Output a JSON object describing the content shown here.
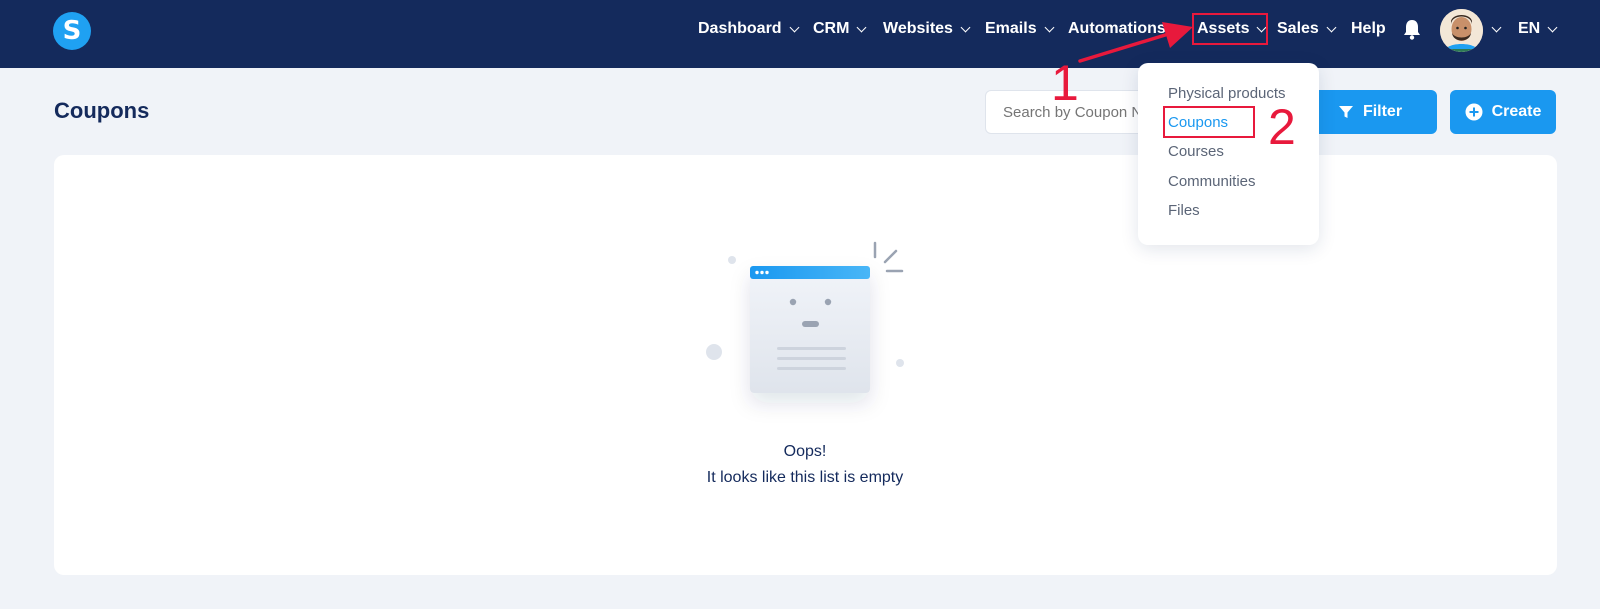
{
  "header": {
    "logo_letter": "S",
    "nav": [
      {
        "label": "Dashboard",
        "chevron": true
      },
      {
        "label": "CRM",
        "chevron": true
      },
      {
        "label": "Websites",
        "chevron": true
      },
      {
        "label": "Emails",
        "chevron": true
      },
      {
        "label": "Automations",
        "chevron": false
      },
      {
        "label": "Assets",
        "chevron": true
      },
      {
        "label": "Sales",
        "chevron": true
      },
      {
        "label": "Help",
        "chevron": false
      }
    ],
    "lang": "EN",
    "icons": [
      "bell-icon",
      "avatar"
    ]
  },
  "page": {
    "title": "Coupons",
    "search_placeholder": "Search by Coupon N",
    "filter_label": "Filter",
    "create_label": "Create",
    "empty_title": "Oops!",
    "empty_text": "It looks like this list is empty"
  },
  "dropdown": {
    "items": [
      "Physical products",
      "Coupons",
      "Courses",
      "Communities",
      "Files"
    ],
    "active_index": 1
  },
  "annotations": {
    "step1": "1",
    "step2": "2"
  },
  "colors": {
    "header_bg": "#142a5c",
    "accent": "#1a98f0",
    "annotation": "#e8193c",
    "page_bg": "#f0f3f8"
  }
}
